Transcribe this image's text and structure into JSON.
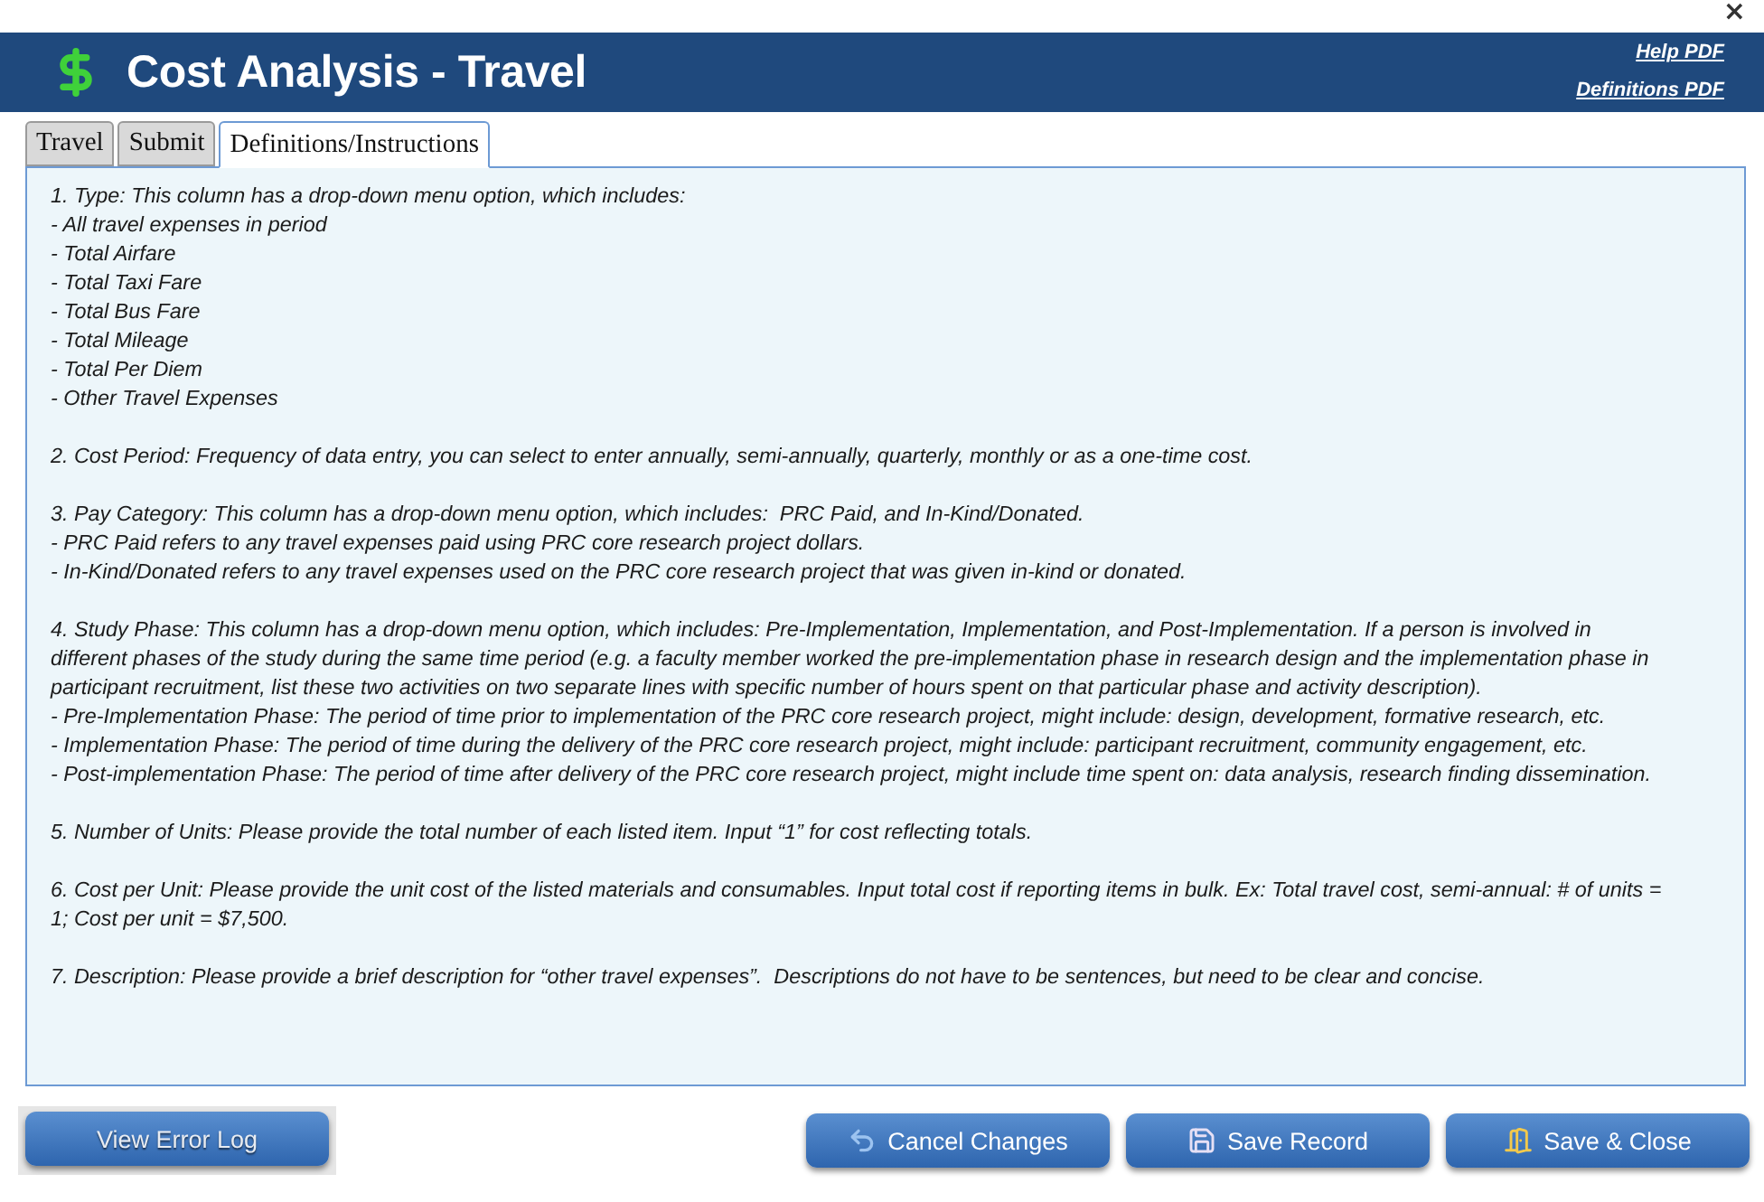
{
  "window": {
    "close_label": "×"
  },
  "header": {
    "title": "Cost Analysis - Travel",
    "links": [
      "Help PDF",
      "Definitions PDF"
    ]
  },
  "tabs": [
    {
      "label": "Travel",
      "selected": false
    },
    {
      "label": "Submit",
      "selected": false
    },
    {
      "label": "Definitions/Instructions",
      "selected": true
    }
  ],
  "instructions": [
    {
      "lines": [
        "1. Type: This column has a drop-down menu option, which includes:",
        "- All travel expenses in period",
        "- Total Airfare",
        "- Total Taxi Fare",
        "- Total Bus Fare",
        "- Total Mileage",
        "- Total Per Diem",
        "- Other Travel Expenses"
      ]
    },
    {
      "lines": [
        "2. Cost Period: Frequency of data entry, you can select to enter annually, semi-annually, quarterly, monthly or as a one-time cost."
      ]
    },
    {
      "lines": [
        "3. Pay Category: This column has a drop-down menu option, which includes:  PRC Paid, and In-Kind/Donated.",
        "- PRC Paid refers to any travel expenses paid using PRC core research project dollars.",
        "- In-Kind/Donated refers to any travel expenses used on the PRC core research project that was given in-kind or donated."
      ]
    },
    {
      "lines": [
        "4. Study Phase: This column has a drop-down menu option, which includes: Pre-Implementation, Implementation, and Post-Implementation. If a person is involved in different phases of the study during the same time period (e.g. a faculty member worked the pre-implementation phase in research design and the implementation phase in participant recruitment, list these two activities on two separate lines with specific number of hours spent on that particular phase and activity description).",
        "- Pre-Implementation Phase: The period of time prior to implementation of the PRC core research project, might include: design, development, formative research, etc.",
        "- Implementation Phase: The period of time during the delivery of the PRC core research project, might include: participant recruitment, community engagement, etc.",
        "- Post-implementation Phase: The period of time after delivery of the PRC core research project, might include time spent on: data analysis, research finding dissemination."
      ]
    },
    {
      "lines": [
        "5. Number of Units: Please provide the total number of each listed item. Input “1” for cost reflecting totals."
      ]
    },
    {
      "lines": [
        "6. Cost per Unit: Please provide the unit cost of the listed materials and consumables. Input total cost if reporting items in bulk. Ex: Total travel cost, semi-annual: # of units = 1; Cost per unit = $7,500."
      ]
    },
    {
      "lines": [
        "7. Description: Please provide a brief description for “other travel expenses”.  Descriptions do not have to be sentences, but need to be clear and concise."
      ]
    }
  ],
  "buttons": [
    {
      "label": "View Error Log",
      "kind": "log"
    },
    {
      "label": "Cancel Changes",
      "kind": "cancel"
    },
    {
      "label": "Save Record",
      "kind": "save"
    },
    {
      "label": "Save & Close",
      "kind": "save_close"
    }
  ]
}
